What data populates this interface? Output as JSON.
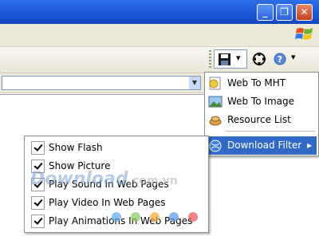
{
  "window": {
    "minimize_glyph": "_",
    "maximize_glyph": "❐",
    "close_glyph": "✕"
  },
  "toolbar": {
    "save_icon": "floppy-disk-icon",
    "dropdown_glyph": "▾",
    "help_dropdown_glyph": "▾"
  },
  "main_menu": {
    "items": [
      {
        "label": "Web To MHT",
        "icon": "web-page-icon"
      },
      {
        "label": "Web To Image",
        "icon": "image-icon"
      },
      {
        "label": "Resource List",
        "icon": "resource-list-icon"
      },
      {
        "label": "Download Filter",
        "icon": "filter-globe-icon",
        "submenu_arrow": "▸",
        "highlighted": true
      }
    ]
  },
  "download_filter_menu": {
    "items": [
      {
        "label": "Show Flash",
        "checked": true
      },
      {
        "label": "Show Picture",
        "checked": true
      },
      {
        "label": "Play Sound In Web Pages",
        "checked": true
      },
      {
        "label": "Play Video In Web Pages",
        "checked": true
      },
      {
        "label": "Play Animations In Web Pages",
        "checked": true
      }
    ]
  },
  "watermark": {
    "brand": "Download",
    "domain": ".com.vn"
  },
  "colors": {
    "titlebar": "#1a56d6",
    "highlight": "#316ac5",
    "menu_bg": "#ffffff"
  }
}
